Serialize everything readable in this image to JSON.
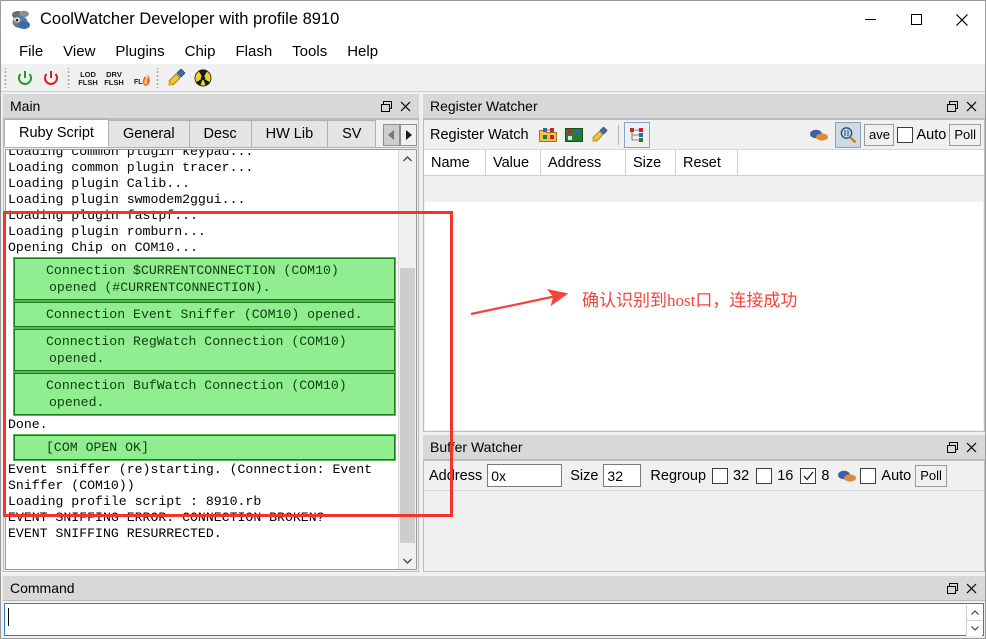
{
  "window": {
    "title": "CoolWatcher Developer with profile 8910",
    "icon": "app-bird-icon",
    "controls": {
      "minimize": "minimize",
      "maximize": "maximize",
      "close": "close"
    }
  },
  "menu": {
    "items": [
      {
        "label": "File"
      },
      {
        "label": "View"
      },
      {
        "label": "Plugins"
      },
      {
        "label": "Chip"
      },
      {
        "label": "Flash"
      },
      {
        "label": "Tools"
      },
      {
        "label": "Help"
      }
    ]
  },
  "toolbar": {
    "groups": [
      {
        "buttons": [
          {
            "name": "power-on-icon",
            "tip": "Power On"
          },
          {
            "name": "power-off-icon",
            "tip": "Power Off"
          }
        ]
      },
      {
        "buttons": [
          {
            "name": "load-flash-icon",
            "tip": "LOD FLSH",
            "line1": "LOD",
            "line2": "FLSH"
          },
          {
            "name": "drive-flash-icon",
            "tip": "DRV FLSH",
            "line1": "DRV",
            "line2": "FLSH"
          },
          {
            "name": "flash-burn-icon",
            "tip": "FL",
            "line1": "FL",
            "line2": ""
          }
        ]
      },
      {
        "buttons": [
          {
            "name": "clear-brush-icon",
            "tip": "Clear"
          },
          {
            "name": "radiation-icon",
            "tip": "Radiation"
          }
        ]
      }
    ]
  },
  "main_panel": {
    "caption": "Main",
    "caption_buttons": [
      "float-icon",
      "close-icon"
    ],
    "tabs": [
      {
        "label": "Ruby Script",
        "active": true
      },
      {
        "label": "General",
        "active": false
      },
      {
        "label": "Desc",
        "active": false
      },
      {
        "label": "HW Lib",
        "active": false
      },
      {
        "label": "SV",
        "active": false
      }
    ],
    "tab_scroll": {
      "left": "◀",
      "right": "▶"
    },
    "log": [
      {
        "type": "text",
        "text": "Loading common plugin keypad..."
      },
      {
        "type": "text",
        "text": "Loading common plugin tracer..."
      },
      {
        "type": "text",
        "text": "Loading plugin Calib..."
      },
      {
        "type": "text",
        "text": "Loading plugin swmodem2ggui..."
      },
      {
        "type": "text",
        "text": "Loading plugin fastpf..."
      },
      {
        "type": "text",
        "text": "Loading plugin romburn..."
      },
      {
        "type": "text",
        "text": "Opening Chip on COM10..."
      },
      {
        "type": "ok",
        "text": "Connection $CURRENTCONNECTION (COM10) opened (#CURRENTCONNECTION)."
      },
      {
        "type": "ok",
        "text": "Connection Event Sniffer (COM10) opened."
      },
      {
        "type": "ok",
        "text": "Connection RegWatch Connection (COM10) opened."
      },
      {
        "type": "ok",
        "text": "Connection BufWatch Connection (COM10) opened."
      },
      {
        "type": "text",
        "text": "Done."
      },
      {
        "type": "ok",
        "text": "[COM OPEN OK]"
      },
      {
        "type": "text",
        "text": "Event sniffer (re)starting. (Connection: Event\nSniffer (COM10))"
      },
      {
        "type": "text",
        "text": "Loading profile script : 8910.rb"
      },
      {
        "type": "text",
        "text": "EVENT SNIFFING ERROR: CONNECTION BROKEN?"
      },
      {
        "type": "text",
        "text": "EVENT SNIFFING RESURRECTED."
      }
    ]
  },
  "register_watcher": {
    "caption": "Register Watcher",
    "caption_buttons": [
      "float-icon",
      "close-icon"
    ],
    "toolbar": {
      "label": "Register Watch",
      "buttons": [
        {
          "name": "open-registers-icon"
        },
        {
          "name": "save-registers-icon"
        },
        {
          "name": "clear-registers-icon"
        },
        {
          "name": "tree-view-icon"
        }
      ],
      "right_buttons": [
        {
          "name": "color-palette-icon"
        },
        {
          "name": "inspect-magnifier-icon",
          "pressed": true
        }
      ],
      "save_label": "ave",
      "auto_label": "Auto",
      "auto_checked": false,
      "poll_label": "Poll"
    },
    "columns": [
      "Name",
      "Value",
      "Address",
      "Size",
      "Reset"
    ],
    "rows": []
  },
  "buffer_watcher": {
    "caption": "Buffer Watcher",
    "caption_buttons": [
      "float-icon",
      "close-icon"
    ],
    "toolbar": {
      "address_label": "Address",
      "address_value": "0x",
      "size_label": "Size",
      "size_value": "32",
      "regroup_label": "Regroup",
      "options": [
        {
          "label": "32",
          "checked": false
        },
        {
          "label": "16",
          "checked": false
        },
        {
          "label": "8",
          "checked": true
        }
      ],
      "color_icon": "color-palette-icon",
      "auto_label": "Auto",
      "auto_checked": false,
      "poll_label": "Poll"
    }
  },
  "command_panel": {
    "caption": "Command",
    "caption_buttons": [
      "float-icon",
      "close-icon"
    ],
    "input_value": "",
    "spinner": {
      "up": "∧",
      "down": "∨"
    }
  },
  "annotation": {
    "text": "确认识别到host口，连接成功",
    "color": "#f4433c",
    "box": "red-highlight-box",
    "arrow": "red-arrow"
  },
  "colors": {
    "annotation_red": "#f4433c",
    "success_green_fill": "#90ee90",
    "success_green_border": "#1a7a1a",
    "caption_bg": "#d8d8d8",
    "panel_bg": "#f0f0f0",
    "focus_blue": "#2e7dd1"
  }
}
